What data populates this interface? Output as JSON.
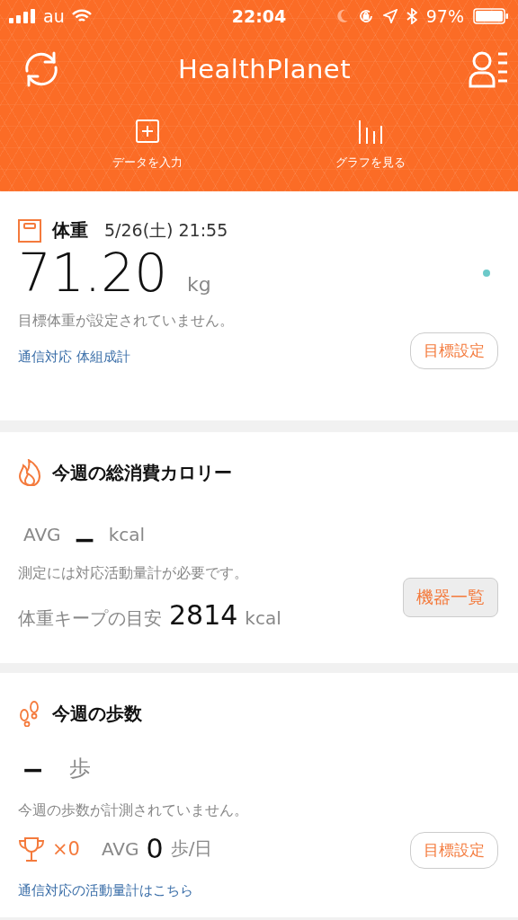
{
  "status_bar": {
    "carrier": "au",
    "time": "22:04",
    "battery": "97%"
  },
  "header": {
    "logo": "HealthPlanet",
    "actions": [
      {
        "kind": "add",
        "label": "データを入力"
      },
      {
        "kind": "graph",
        "label": "グラフを見る"
      }
    ]
  },
  "weight": {
    "title": "体重",
    "date": "5/26(土) 21:55",
    "value": "71.20",
    "unit": "kg",
    "note": "目標体重が設定されていません。",
    "link": "通信対応 体組成計",
    "button": "目標設定"
  },
  "calories": {
    "title": "今週の総消費カロリー",
    "avg_label": "AVG",
    "value": "−",
    "unit": "kcal",
    "note": "測定には対応活動量計が必要です。",
    "keep_label": "体重キープの目安",
    "keep_value": "2814",
    "keep_unit": "kcal",
    "button": "機器一覧"
  },
  "steps": {
    "title": "今週の歩数",
    "value": "−",
    "unit": "歩",
    "note": "今週の歩数が計測されていません。",
    "trophy_count": "×0",
    "avg_label": "AVG",
    "avg_value": "0",
    "avg_unit": "歩/日",
    "button": "目標設定",
    "link": "通信対応の活動量計はこちら"
  }
}
